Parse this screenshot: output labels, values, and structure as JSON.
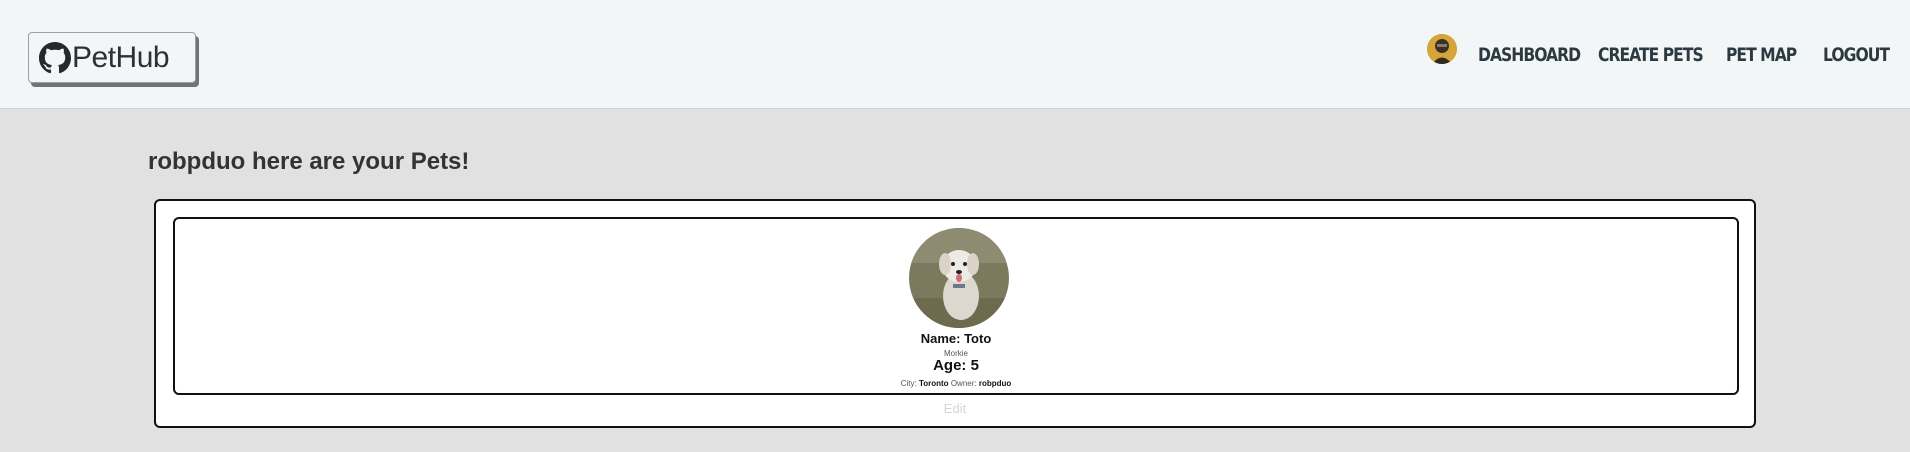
{
  "app": {
    "brand": "PetHub"
  },
  "nav": {
    "avatar_icon": "user-avatar",
    "links": [
      "DASHBOARD",
      "CREATE PETS",
      "PET MAP",
      "LOGOUT"
    ]
  },
  "page": {
    "heading": "robpduo here are your Pets!"
  },
  "pets": [
    {
      "name_label": "Name: Toto",
      "breed": "Morkie",
      "age_label": "Age: 5",
      "city_label": "City:",
      "city": "Toronto",
      "owner_label": "Owner:",
      "owner": "robpduo",
      "edit_label": "Edit"
    }
  ],
  "colors": {
    "navbar": "#f3f6f7",
    "page_bg": "#e1e1e1",
    "nav_text": "#2c3940"
  }
}
